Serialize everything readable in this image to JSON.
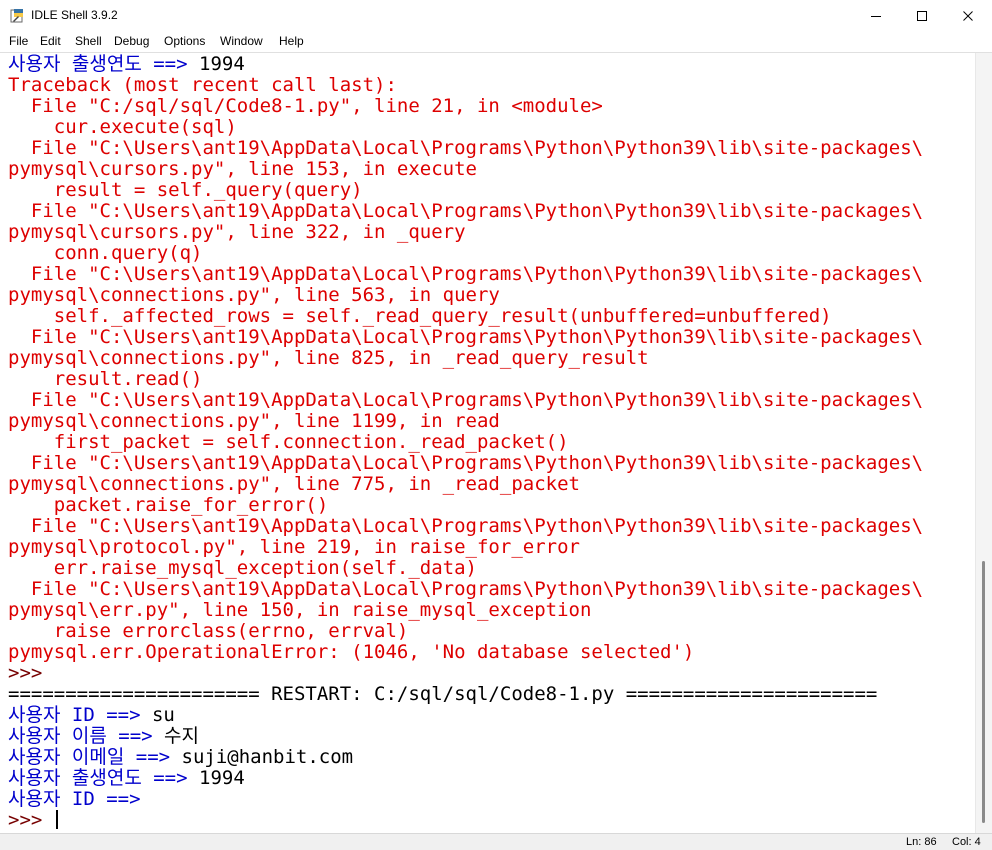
{
  "window": {
    "title": "IDLE Shell 3.9.2",
    "icon": "python-idle-icon"
  },
  "window_controls": {
    "minimize_icon": "minimize-icon",
    "maximize_icon": "maximize-icon",
    "close_icon": "close-icon"
  },
  "menu": [
    "File",
    "Edit",
    "Shell",
    "Debug",
    "Options",
    "Window",
    "Help"
  ],
  "colors": {
    "stdout": "#0000cc",
    "stderr": "#dd0000",
    "input": "#000000",
    "prompt": "#770000"
  },
  "shell_lines": [
    {
      "parts": [
        {
          "t": "사용자 출생연도 ==> ",
          "k": "out"
        },
        {
          "t": "1994",
          "k": "inp"
        }
      ]
    },
    {
      "parts": [
        {
          "t": "Traceback (most recent call last):",
          "k": "err"
        }
      ]
    },
    {
      "parts": [
        {
          "t": "  File \"C:/sql/sql/Code8-1.py\", line 21, in <module>",
          "k": "err"
        }
      ]
    },
    {
      "parts": [
        {
          "t": "    cur.execute(sql)",
          "k": "err"
        }
      ]
    },
    {
      "parts": [
        {
          "t": "  File \"C:\\Users\\ant19\\AppData\\Local\\Programs\\Python\\Python39\\lib\\site-packages\\",
          "k": "err"
        }
      ]
    },
    {
      "parts": [
        {
          "t": "pymysql\\cursors.py\", line 153, in execute",
          "k": "err"
        }
      ]
    },
    {
      "parts": [
        {
          "t": "    result = self._query(query)",
          "k": "err"
        }
      ]
    },
    {
      "parts": [
        {
          "t": "  File \"C:\\Users\\ant19\\AppData\\Local\\Programs\\Python\\Python39\\lib\\site-packages\\",
          "k": "err"
        }
      ]
    },
    {
      "parts": [
        {
          "t": "pymysql\\cursors.py\", line 322, in _query",
          "k": "err"
        }
      ]
    },
    {
      "parts": [
        {
          "t": "    conn.query(q)",
          "k": "err"
        }
      ]
    },
    {
      "parts": [
        {
          "t": "  File \"C:\\Users\\ant19\\AppData\\Local\\Programs\\Python\\Python39\\lib\\site-packages\\",
          "k": "err"
        }
      ]
    },
    {
      "parts": [
        {
          "t": "pymysql\\connections.py\", line 563, in query",
          "k": "err"
        }
      ]
    },
    {
      "parts": [
        {
          "t": "    self._affected_rows = self._read_query_result(unbuffered=unbuffered)",
          "k": "err"
        }
      ]
    },
    {
      "parts": [
        {
          "t": "  File \"C:\\Users\\ant19\\AppData\\Local\\Programs\\Python\\Python39\\lib\\site-packages\\",
          "k": "err"
        }
      ]
    },
    {
      "parts": [
        {
          "t": "pymysql\\connections.py\", line 825, in _read_query_result",
          "k": "err"
        }
      ]
    },
    {
      "parts": [
        {
          "t": "    result.read()",
          "k": "err"
        }
      ]
    },
    {
      "parts": [
        {
          "t": "  File \"C:\\Users\\ant19\\AppData\\Local\\Programs\\Python\\Python39\\lib\\site-packages\\",
          "k": "err"
        }
      ]
    },
    {
      "parts": [
        {
          "t": "pymysql\\connections.py\", line 1199, in read",
          "k": "err"
        }
      ]
    },
    {
      "parts": [
        {
          "t": "    first_packet = self.connection._read_packet()",
          "k": "err"
        }
      ]
    },
    {
      "parts": [
        {
          "t": "  File \"C:\\Users\\ant19\\AppData\\Local\\Programs\\Python\\Python39\\lib\\site-packages\\",
          "k": "err"
        }
      ]
    },
    {
      "parts": [
        {
          "t": "pymysql\\connections.py\", line 775, in _read_packet",
          "k": "err"
        }
      ]
    },
    {
      "parts": [
        {
          "t": "    packet.raise_for_error()",
          "k": "err"
        }
      ]
    },
    {
      "parts": [
        {
          "t": "  File \"C:\\Users\\ant19\\AppData\\Local\\Programs\\Python\\Python39\\lib\\site-packages\\",
          "k": "err"
        }
      ]
    },
    {
      "parts": [
        {
          "t": "pymysql\\protocol.py\", line 219, in raise_for_error",
          "k": "err"
        }
      ]
    },
    {
      "parts": [
        {
          "t": "    err.raise_mysql_exception(self._data)",
          "k": "err"
        }
      ]
    },
    {
      "parts": [
        {
          "t": "  File \"C:\\Users\\ant19\\AppData\\Local\\Programs\\Python\\Python39\\lib\\site-packages\\",
          "k": "err"
        }
      ]
    },
    {
      "parts": [
        {
          "t": "pymysql\\err.py\", line 150, in raise_mysql_exception",
          "k": "err"
        }
      ]
    },
    {
      "parts": [
        {
          "t": "    raise errorclass(errno, errval)",
          "k": "err"
        }
      ]
    },
    {
      "parts": [
        {
          "t": "pymysql.err.OperationalError: (1046, 'No database selected')",
          "k": "err"
        }
      ]
    },
    {
      "parts": [
        {
          "t": ">>> ",
          "k": "prompt"
        }
      ]
    },
    {
      "parts": [
        {
          "t": "====================== RESTART: C:/sql/sql/Code8-1.py ======================",
          "k": "restart"
        }
      ]
    },
    {
      "parts": [
        {
          "t": "사용자 ID ==> ",
          "k": "out"
        },
        {
          "t": "su",
          "k": "inp"
        }
      ]
    },
    {
      "parts": [
        {
          "t": "사용자 이름 ==> ",
          "k": "out"
        },
        {
          "t": "수지",
          "k": "inp"
        }
      ]
    },
    {
      "parts": [
        {
          "t": "사용자 이메일 ==> ",
          "k": "out"
        },
        {
          "t": "suji@hanbit.com",
          "k": "inp"
        }
      ]
    },
    {
      "parts": [
        {
          "t": "사용자 출생연도 ==> ",
          "k": "out"
        },
        {
          "t": "1994",
          "k": "inp"
        }
      ]
    },
    {
      "parts": [
        {
          "t": "사용자 ID ==> ",
          "k": "out"
        }
      ]
    },
    {
      "parts": [
        {
          "t": ">>> ",
          "k": "prompt"
        }
      ],
      "cursor": true
    }
  ],
  "status": {
    "ln": "Ln: 86",
    "col": "Col: 4"
  }
}
